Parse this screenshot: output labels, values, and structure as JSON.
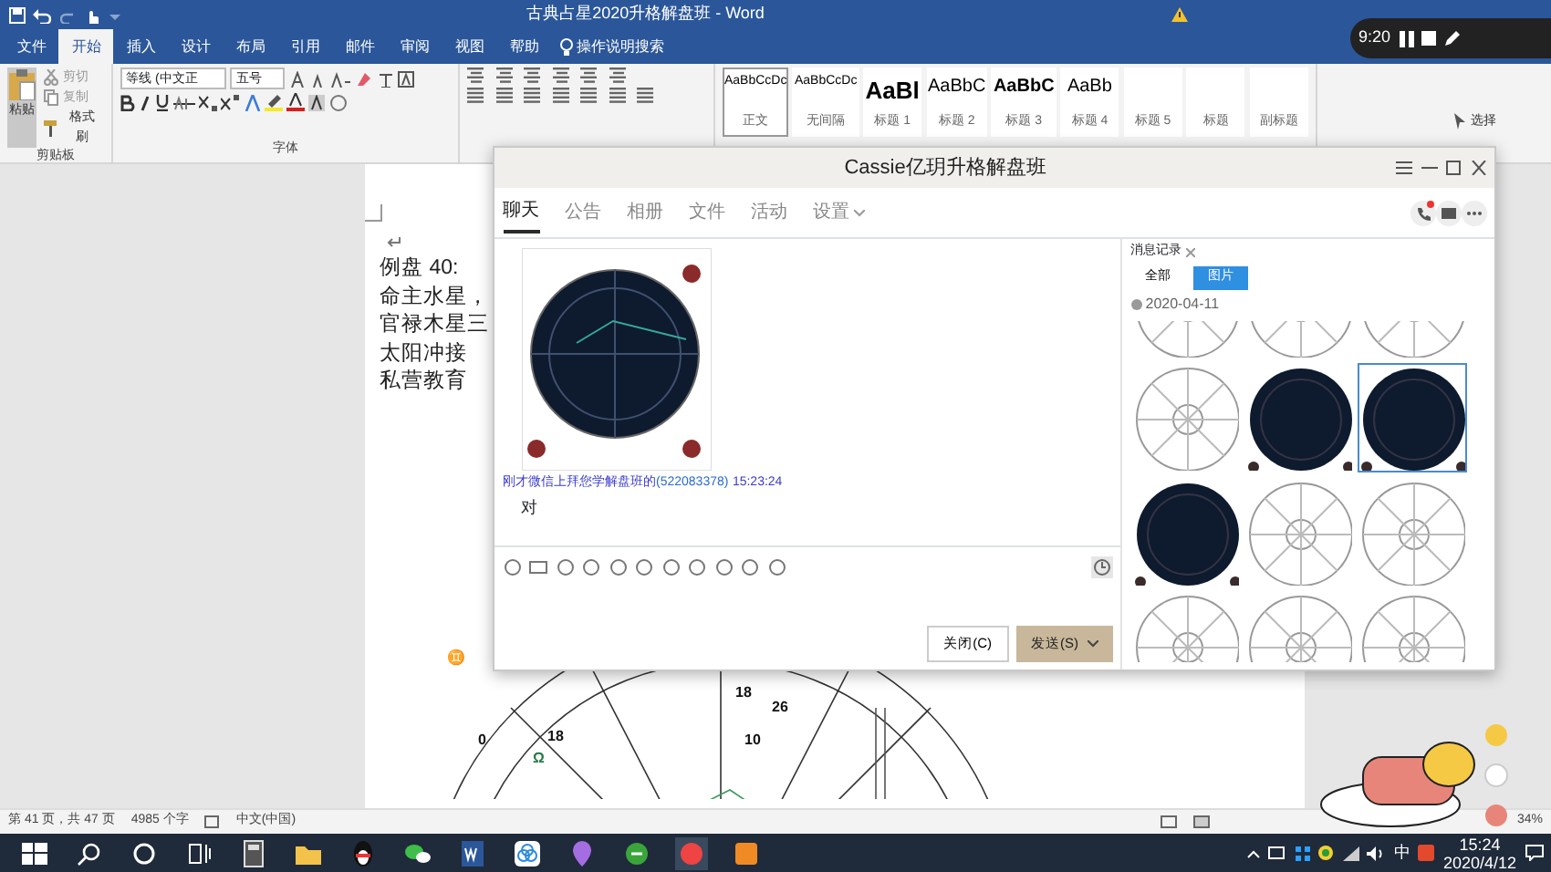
{
  "word": {
    "title": "古典占星2020升格解盘班 - Word",
    "tabs": [
      {
        "label": "文件",
        "selected": false
      },
      {
        "label": "开始",
        "selected": true
      },
      {
        "label": "插入",
        "selected": false
      },
      {
        "label": "设计",
        "selected": false
      },
      {
        "label": "布局",
        "selected": false
      },
      {
        "label": "引用",
        "selected": false
      },
      {
        "label": "邮件",
        "selected": false
      },
      {
        "label": "审阅",
        "selected": false
      },
      {
        "label": "视图",
        "selected": false
      },
      {
        "label": "帮助",
        "selected": false
      }
    ],
    "tell_me": "操作说明搜索",
    "clipboard": {
      "paste": "粘贴",
      "cut": "剪切",
      "copy": "复制",
      "format_painter": "格式刷",
      "label": "剪贴板"
    },
    "font": {
      "name": "等线 (中文正",
      "size": "五号",
      "label": "字体"
    },
    "styles": [
      {
        "preview": "AaBbCcDc",
        "name": "正文",
        "selected": true
      },
      {
        "preview": "AaBbCcDc",
        "name": "无间隔",
        "selected": false
      },
      {
        "preview": "AaBl",
        "name": "标题 1",
        "selected": false
      },
      {
        "preview": "AaBbC",
        "name": "标题 2",
        "selected": false
      },
      {
        "preview": "AaBbC",
        "name": "标题 3",
        "selected": false
      },
      {
        "preview": "AaBb",
        "name": "标题 4",
        "selected": false
      },
      {
        "name": "标题 5",
        "selected": false
      },
      {
        "name": "标题",
        "selected": false
      },
      {
        "name": "副标题",
        "selected": false
      }
    ],
    "editing": {
      "select": "选择"
    },
    "document": {
      "lines": [
        "例盘 40:",
        "命主水星，",
        "官禄木星三",
        "太阳冲接",
        "私营教育"
      ],
      "wheel_labels": [
        "0",
        "18",
        "Ω",
        "18",
        "26",
        "10",
        "♊"
      ]
    },
    "status_bar": {
      "page": "第 41 页，共 47 页",
      "words": "4985 个字",
      "language": "中文(中国)",
      "zoom": "34%"
    }
  },
  "recorder": {
    "time": "9:20"
  },
  "chat": {
    "title": "Cassie亿玥升格解盘班",
    "tabs": [
      {
        "label": "聊天",
        "selected": true
      },
      {
        "label": "公告",
        "selected": false
      },
      {
        "label": "相册",
        "selected": false
      },
      {
        "label": "文件",
        "selected": false
      },
      {
        "label": "活动",
        "selected": false
      },
      {
        "label": "设置",
        "selected": false
      }
    ],
    "message": {
      "sender": "刚才微信上拜您学解盘班的",
      "number": "(522083378)",
      "time": "15:23:24",
      "text": "对"
    },
    "close_button": "关闭(C)",
    "send_button": "发送(S)",
    "history": {
      "title": "消息记录",
      "filters": [
        {
          "label": "全部",
          "selected": false
        },
        {
          "label": "图片",
          "selected": true
        }
      ],
      "date": "2020-04-11",
      "thumbnails": [
        {
          "kind": "light",
          "selected": false
        },
        {
          "kind": "light",
          "selected": false
        },
        {
          "kind": "light",
          "selected": false
        },
        {
          "kind": "light",
          "selected": false
        },
        {
          "kind": "dark",
          "selected": false
        },
        {
          "kind": "dark",
          "selected": true
        },
        {
          "kind": "dark",
          "selected": false
        },
        {
          "kind": "light",
          "selected": false
        },
        {
          "kind": "light",
          "selected": false
        },
        {
          "kind": "light",
          "selected": false
        },
        {
          "kind": "light",
          "selected": false
        },
        {
          "kind": "light",
          "selected": false
        }
      ]
    }
  },
  "taskbar": {
    "ime": "中",
    "time": "15:24",
    "date": "2020/4/12"
  }
}
